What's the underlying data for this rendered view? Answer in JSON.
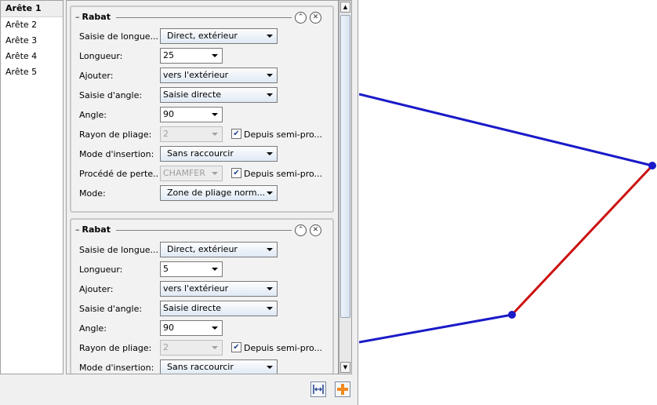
{
  "edges": [
    {
      "label": "Arête 1",
      "selected": true
    },
    {
      "label": "Arête 2",
      "selected": false
    },
    {
      "label": "Arête 3",
      "selected": false
    },
    {
      "label": "Arête 4",
      "selected": false
    },
    {
      "label": "Arête 5",
      "selected": false
    }
  ],
  "groups": [
    {
      "title": "Rabat",
      "fields": {
        "length_entry_label": "Saisie de longue...",
        "length_entry_value": "Direct, extérieur",
        "length_label": "Longueur:",
        "length_value": "25",
        "add_label": "Ajouter:",
        "add_value": "vers l'extérieur",
        "angle_entry_label": "Saisie d'angle:",
        "angle_entry_value": "Saisie directe",
        "angle_label": "Angle:",
        "angle_value": "90",
        "radius_label": "Rayon de pliage:",
        "radius_value": "2",
        "radius_check_label": "Depuis semi-pro...",
        "insert_label": "Mode d'insertion:",
        "insert_value": "Sans raccourcir",
        "loss_label": "Procédé de perte...",
        "loss_value": "CHAMFER",
        "loss_check_label": "Depuis semi-pro...",
        "mode_label": "Mode:",
        "mode_value": "Zone de pliage norm..."
      }
    },
    {
      "title": "Rabat",
      "fields": {
        "length_entry_label": "Saisie de longue...",
        "length_entry_value": "Direct, extérieur",
        "length_label": "Longueur:",
        "length_value": "5",
        "add_label": "Ajouter:",
        "add_value": "vers l'extérieur",
        "angle_entry_label": "Saisie d'angle:",
        "angle_entry_value": "Saisie directe",
        "angle_label": "Angle:",
        "angle_value": "90",
        "radius_label": "Rayon de pliage:",
        "radius_value": "2",
        "radius_check_label": "Depuis semi-pro...",
        "insert_label": "Mode d'insertion:",
        "insert_value": "Sans raccourcir"
      }
    }
  ],
  "icons": {
    "collapse": "chevron-up-icon",
    "remove": "close-icon",
    "toolbar_left": "distribute-icon",
    "toolbar_right": "add-icon"
  },
  "colors": {
    "edge_blue": "#1a1ac8",
    "edge_red": "#cc1111",
    "accent_orange": "#f08a20"
  }
}
